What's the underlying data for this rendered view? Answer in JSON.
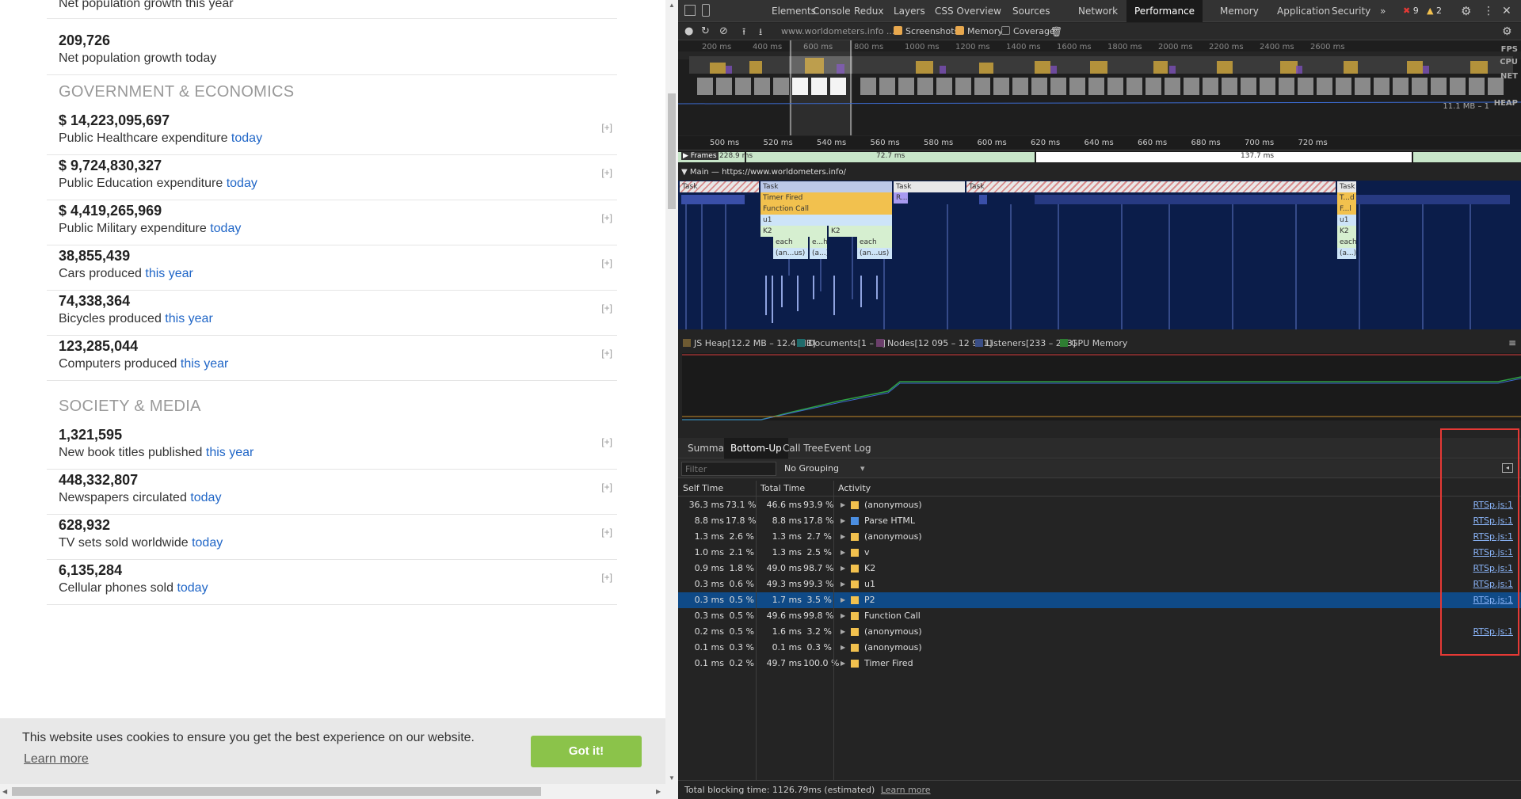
{
  "page": {
    "top_partial": "Net population growth this year",
    "sections": [
      {
        "title": "GOVERNMENT & ECONOMICS",
        "stats": [
          {
            "value": "$ 14,223,095,697",
            "label": "Public Healthcare expenditure",
            "accent": "today"
          },
          {
            "value": "$ 9,724,830,327",
            "label": "Public Education expenditure",
            "accent": "today"
          },
          {
            "value": "$ 4,419,265,969",
            "label": "Public Military expenditure",
            "accent": "today"
          },
          {
            "value": "38,855,439",
            "label": "Cars produced",
            "accent": "this year"
          },
          {
            "value": "74,338,364",
            "label": "Bicycles produced",
            "accent": "this year"
          },
          {
            "value": "123,285,044",
            "label": "Computers produced",
            "accent": "this year"
          }
        ]
      },
      {
        "title": "SOCIETY & MEDIA",
        "stats": [
          {
            "value": "1,321,595",
            "label": "New book titles published",
            "accent": "this year"
          },
          {
            "value": "448,332,807",
            "label": "Newspapers circulated",
            "accent": "today"
          },
          {
            "value": "628,932",
            "label": "TV sets sold worldwide",
            "accent": "today"
          },
          {
            "value": "6,135,284",
            "label": "Cellular phones sold",
            "accent": "today"
          }
        ]
      }
    ],
    "first_stat": {
      "value": "209,726",
      "label": "Net population growth today",
      "accent": ""
    },
    "expand_label": "[+]",
    "cookie": {
      "message": "This website uses cookies to ensure you get the best experience on our website.",
      "learn_more": "Learn more",
      "button": "Got it!"
    }
  },
  "devtools": {
    "tabs": [
      "Elements",
      "Console",
      "Redux",
      "Layers",
      "CSS Overview",
      "Sources",
      "Network",
      "Performance",
      "Memory",
      "Application",
      "Security"
    ],
    "active_tab": "Performance",
    "more_tabs": "»",
    "errors": "9",
    "warnings": "2",
    "url": "www.worldometers.info ...",
    "screenshots": "Screenshots",
    "memory": "Memory",
    "coverage": "Coverage",
    "overview_ticks": [
      "200 ms",
      "400 ms",
      "600 ms",
      "800 ms",
      "1000 ms",
      "1200 ms",
      "1400 ms",
      "1600 ms",
      "1800 ms",
      "2000 ms",
      "2200 ms",
      "2400 ms",
      "2600 ms"
    ],
    "overview_labels": {
      "fps": "FPS",
      "cpu": "CPU",
      "net": "NET",
      "heap": "HEAP",
      "heap_val": "11.1 MB – 1"
    },
    "ruler_ticks": [
      "500 ms",
      "520 ms",
      "540 ms",
      "560 ms",
      "580 ms",
      "600 ms",
      "620 ms",
      "640 ms",
      "660 ms",
      "680 ms",
      "700 ms",
      "720 ms"
    ],
    "frames": {
      "label": "Frames",
      "v1": "228.9 ms",
      "v2": "72.7 ms",
      "v3": "137.7 ms"
    },
    "main_label": "▼ Main — https://www.worldometers.info/",
    "flame": {
      "task": "Task",
      "timer": "Timer Fired",
      "func": "Function Call",
      "u1": "u1",
      "k2": "K2",
      "each": "each",
      "eh": "e...h",
      "anus": "(an...us)",
      "a": "(a...)",
      "r": "R...",
      "t": "T...d",
      "f": "F...l"
    },
    "memory_legend": [
      {
        "label": "JS Heap[12.2 MB – 12.4 MB]",
        "color": "#6e5a32"
      },
      {
        "label": "Documents[1 – 2]",
        "color": "#1f6b6b"
      },
      {
        "label": "Nodes[12 095 – 12 951]",
        "color": "#6b3f6b"
      },
      {
        "label": "Listeners[233 – 233]",
        "color": "#3a4e86"
      },
      {
        "label": "GPU Memory",
        "color": "#2e7d32"
      }
    ],
    "bottom_tabs": [
      "Summary",
      "Bottom-Up",
      "Call Tree",
      "Event Log"
    ],
    "active_bottom_tab": "Bottom-Up",
    "filter_placeholder": "Filter",
    "grouping": "No Grouping",
    "columns": {
      "self": "Self Time",
      "total": "Total Time",
      "activity": "Activity"
    },
    "rows": [
      {
        "self": "36.3 ms",
        "selfp": "73.1 %",
        "total": "46.6 ms",
        "totalp": "93.9 %",
        "activity": "(anonymous)",
        "color": "#f2c14e",
        "src": "RTSp.js:1"
      },
      {
        "self": "8.8 ms",
        "selfp": "17.8 %",
        "total": "8.8 ms",
        "totalp": "17.8 %",
        "activity": "Parse HTML",
        "color": "#4b8ee0",
        "src": "RTSp.js:1"
      },
      {
        "self": "1.3 ms",
        "selfp": "2.6 %",
        "total": "1.3 ms",
        "totalp": "2.7 %",
        "activity": "(anonymous)",
        "color": "#f2c14e",
        "src": "RTSp.js:1"
      },
      {
        "self": "1.0 ms",
        "selfp": "2.1 %",
        "total": "1.3 ms",
        "totalp": "2.5 %",
        "activity": "v",
        "color": "#f2c14e",
        "src": "RTSp.js:1"
      },
      {
        "self": "0.9 ms",
        "selfp": "1.8 %",
        "total": "49.0 ms",
        "totalp": "98.7 %",
        "activity": "K2",
        "color": "#f2c14e",
        "src": "RTSp.js:1"
      },
      {
        "self": "0.3 ms",
        "selfp": "0.6 %",
        "total": "49.3 ms",
        "totalp": "99.3 %",
        "activity": "u1",
        "color": "#f2c14e",
        "src": "RTSp.js:1"
      },
      {
        "self": "0.3 ms",
        "selfp": "0.5 %",
        "total": "1.7 ms",
        "totalp": "3.5 %",
        "activity": "P2",
        "color": "#f2c14e",
        "src": "RTSp.js:1"
      },
      {
        "self": "0.3 ms",
        "selfp": "0.5 %",
        "total": "49.6 ms",
        "totalp": "99.8 %",
        "activity": "Function Call",
        "color": "#f2c14e",
        "src": ""
      },
      {
        "self": "0.2 ms",
        "selfp": "0.5 %",
        "total": "1.6 ms",
        "totalp": "3.2 %",
        "activity": "(anonymous)",
        "color": "#f2c14e",
        "src": "RTSp.js:1"
      },
      {
        "self": "0.1 ms",
        "selfp": "0.3 %",
        "total": "0.1 ms",
        "totalp": "0.3 %",
        "activity": "(anonymous)",
        "color": "#f2c14e",
        "src": ""
      },
      {
        "self": "0.1 ms",
        "selfp": "0.2 %",
        "total": "49.7 ms",
        "totalp": "100.0 %",
        "activity": "Timer Fired",
        "color": "#f2c14e",
        "src": ""
      }
    ],
    "selected_row": 6,
    "status": "Total blocking time: 1126.79ms (estimated)",
    "status_link": "Learn more"
  }
}
